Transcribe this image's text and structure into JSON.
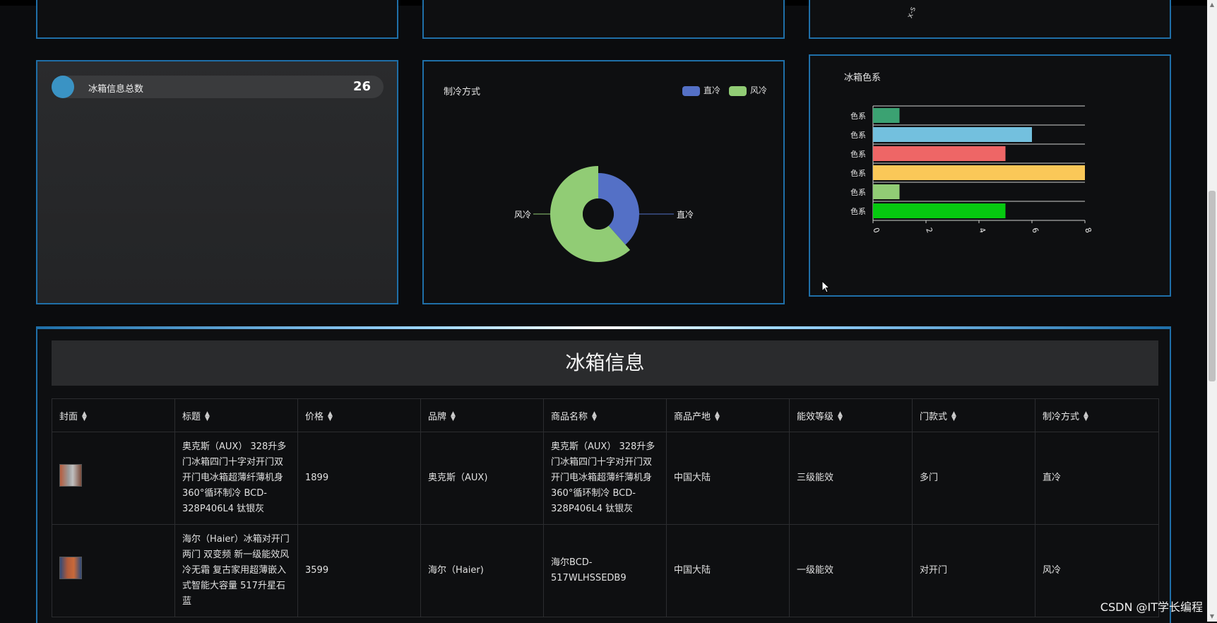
{
  "stat": {
    "label": "冰箱信息总数",
    "value": "26"
  },
  "cooling_panel": {
    "title": "制冷方式",
    "legend": [
      "直冷",
      "风冷"
    ],
    "colors": {
      "直冷": "#5470c6",
      "风冷": "#91cc75"
    },
    "label_left": "风冷",
    "label_right": "直冷"
  },
  "color_panel": {
    "title": "冰箱色系",
    "y_labels": [
      "色系",
      "色系",
      "色系",
      "色系",
      "色系",
      "色系"
    ],
    "x_ticks": [
      "0",
      "2",
      "4",
      "6",
      "8"
    ]
  },
  "chart_data": [
    {
      "type": "pie",
      "title": "制冷方式",
      "labels": [
        "直冷",
        "风冷"
      ],
      "values": [
        10,
        16
      ],
      "colors": [
        "#5470c6",
        "#91cc75"
      ]
    },
    {
      "type": "bar",
      "title": "冰箱色系",
      "orientation": "horizontal",
      "categories": [
        "色系",
        "色系",
        "色系",
        "色系",
        "色系",
        "色系"
      ],
      "values": [
        1,
        6,
        5,
        8,
        1,
        5
      ],
      "colors": [
        "#3ba272",
        "#73c0de",
        "#ee6666",
        "#fac858",
        "#91cc75",
        "#06c910"
      ],
      "xlim": [
        0,
        8
      ]
    }
  ],
  "table": {
    "title": "冰箱信息",
    "columns": [
      "封面",
      "标题",
      "价格",
      "品牌",
      "商品名称",
      "商品产地",
      "能效等级",
      "门款式",
      "制冷方式"
    ],
    "rows": [
      {
        "title": "奥克斯（AUX） 328升多门冰箱四门十字对开门双开门电冰箱超薄纤薄机身 360°循环制冷 BCD-328P406L4 钛银灰",
        "price": "1899",
        "brand": "奥克斯（AUX)",
        "name": "奥克斯（AUX） 328升多门冰箱四门十字对开门双开门电冰箱超薄纤薄机身 360°循环制冷 BCD-328P406L4 钛银灰",
        "origin": "中国大陆",
        "energy": "三级能效",
        "door": "多门",
        "cooling": "直冷"
      },
      {
        "title": "海尔（Haier）冰箱对开门两门 双变频 新一级能效风冷无霜 复古家用超薄嵌入式智能大容量 517升星石蓝",
        "price": "3599",
        "brand": "海尔（Haier)",
        "name": "海尔BCD-517WLHSSEDB9",
        "origin": "中国大陆",
        "energy": "一级能效",
        "door": "对开门",
        "cooling": "风冷"
      }
    ]
  },
  "watermark": "CSDN @IT学长编程",
  "top_partial_text": "x-s"
}
